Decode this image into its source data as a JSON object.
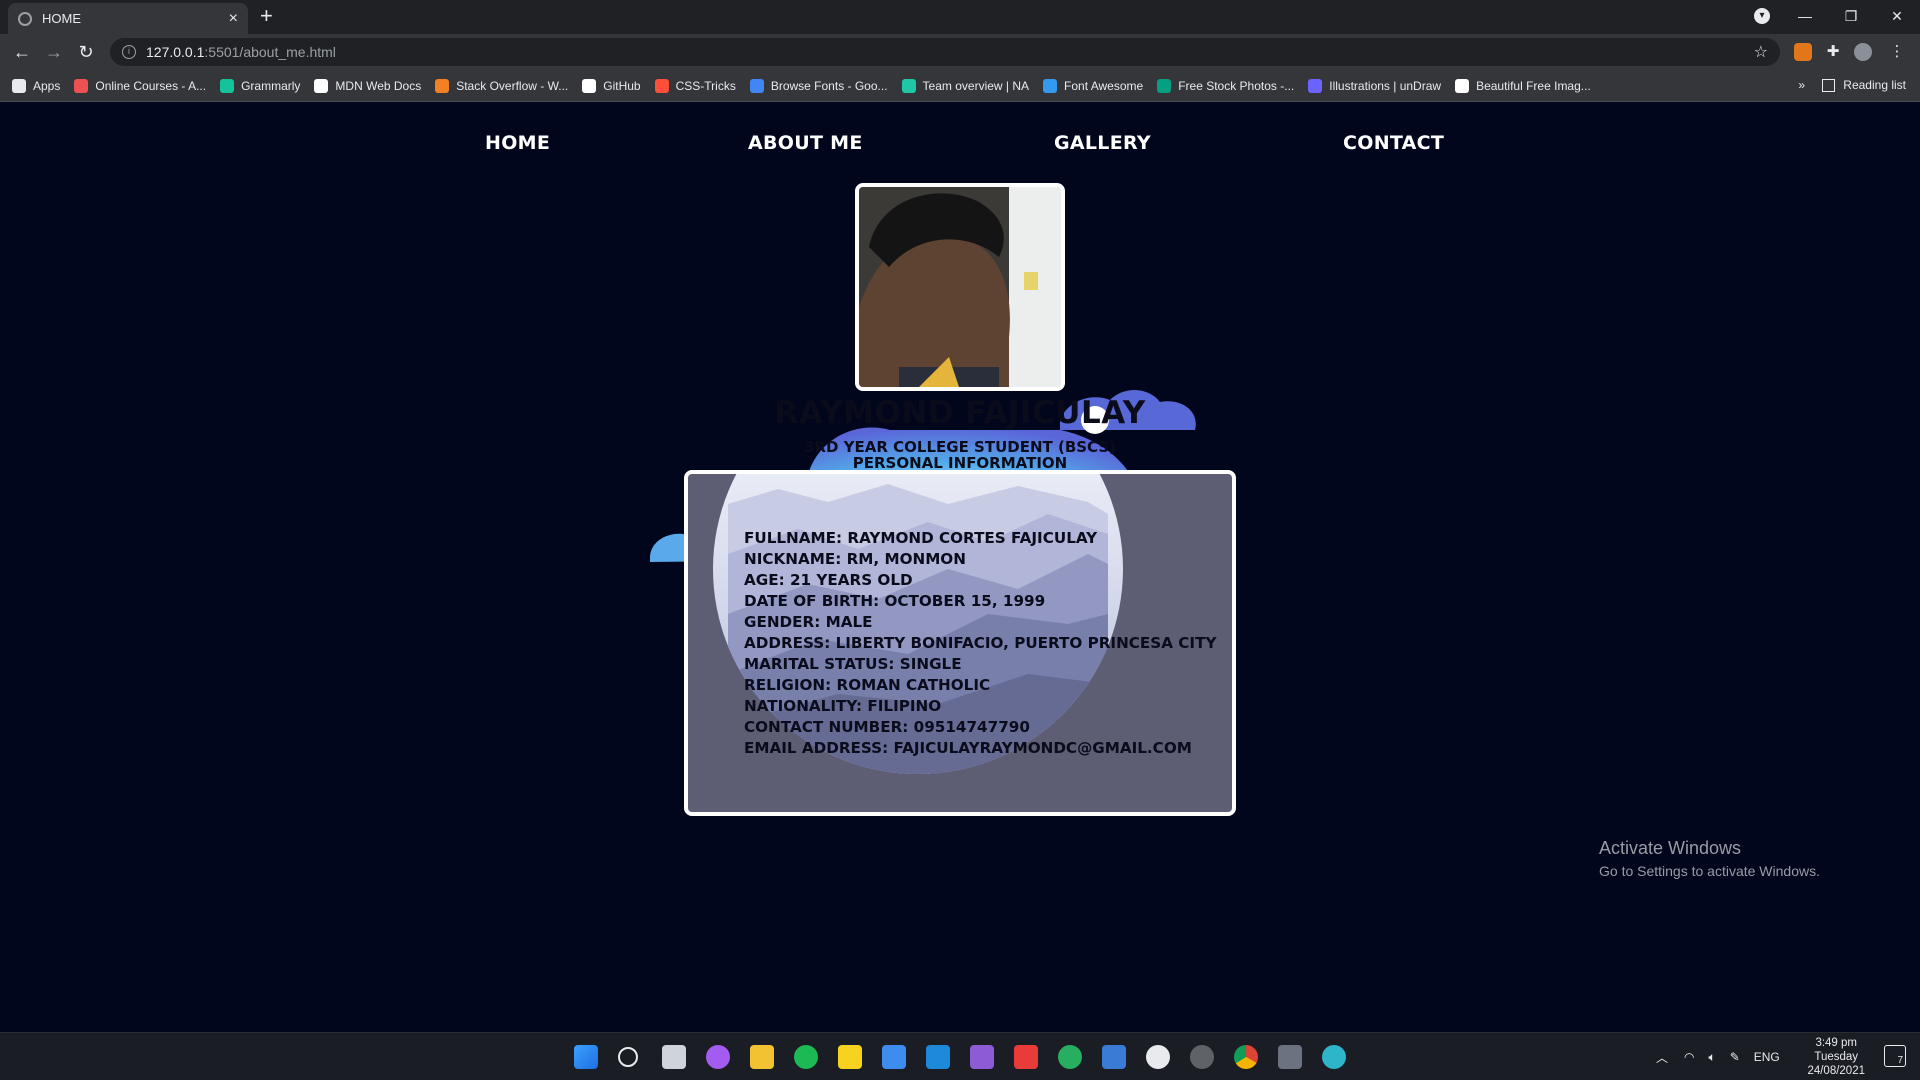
{
  "browser": {
    "tab_title": "HOME",
    "url_host": "127.0.0.1",
    "url_path": ":5501/about_me.html",
    "bookmarks": [
      {
        "label": "Apps",
        "icon": "apps-grid-icon",
        "color": "#e8eaed"
      },
      {
        "label": "Online Courses - A...",
        "icon": "udemy-icon",
        "color": "#ec5252"
      },
      {
        "label": "Grammarly",
        "icon": "grammarly-icon",
        "color": "#15c39a"
      },
      {
        "label": "MDN Web Docs",
        "icon": "mdn-icon",
        "color": "#ffffff"
      },
      {
        "label": "Stack Overflow - W...",
        "icon": "stackoverflow-icon",
        "color": "#f48024"
      },
      {
        "label": "GitHub",
        "icon": "github-icon",
        "color": "#ffffff"
      },
      {
        "label": "CSS-Tricks",
        "icon": "csstricks-icon",
        "color": "#ff4f3b"
      },
      {
        "label": "Browse Fonts - Goo...",
        "icon": "google-fonts-icon",
        "color": "#4285f4"
      },
      {
        "label": "Team overview | NA",
        "icon": "team-icon",
        "color": "#1ec8a5"
      },
      {
        "label": "Font Awesome",
        "icon": "fontawesome-icon",
        "color": "#339af0"
      },
      {
        "label": "Free Stock Photos -...",
        "icon": "stock-photos-icon",
        "color": "#05a081"
      },
      {
        "label": "Illustrations | unDraw",
        "icon": "undraw-icon",
        "color": "#6c63ff"
      },
      {
        "label": "Beautiful Free Imag...",
        "icon": "unsplash-icon",
        "color": "#ffffff"
      }
    ],
    "bookmarks_more": "»",
    "reading_list": "Reading list"
  },
  "nav": {
    "home": "HOME",
    "about": "ABOUT ME",
    "gallery": "GALLERY",
    "contact": "CONTACT"
  },
  "profile": {
    "name": "RAYMOND FAJICULAY",
    "subtitle": "3RD YEAR COLLEGE STUDENT (BSCS)",
    "section_title": "PERSONAL INFORMATION",
    "details": [
      "FULLNAME: RAYMOND CORTES FAJICULAY",
      "NICKNAME: RM, MONMON",
      "AGE: 21 YEARS OLD",
      "DATE OF BIRTH: OCTOBER 15, 1999",
      "GENDER: MALE",
      "ADDRESS: LIBERTY BONIFACIO, PUERTO PRINCESA CITY",
      "MARITAL STATUS: SINGLE",
      "RELIGION: ROMAN CATHOLIC",
      "NATIONALITY: FILIPINO",
      "CONTACT NUMBER: 09514747790",
      "EMAIL ADDRESS: FAJICULAYRAYMONDC@GMAIL.COM"
    ]
  },
  "watermark": {
    "title": "Activate Windows",
    "subtitle": "Go to Settings to activate Windows."
  },
  "taskbar": {
    "language": "ENG",
    "time": "3:49 pm",
    "day": "Tuesday",
    "date": "24/08/2021",
    "notification_count": "7"
  },
  "colors": {
    "page_bg": "#02061c",
    "card_bg": "#5d5d73",
    "text_dark": "#0a0c1c"
  }
}
